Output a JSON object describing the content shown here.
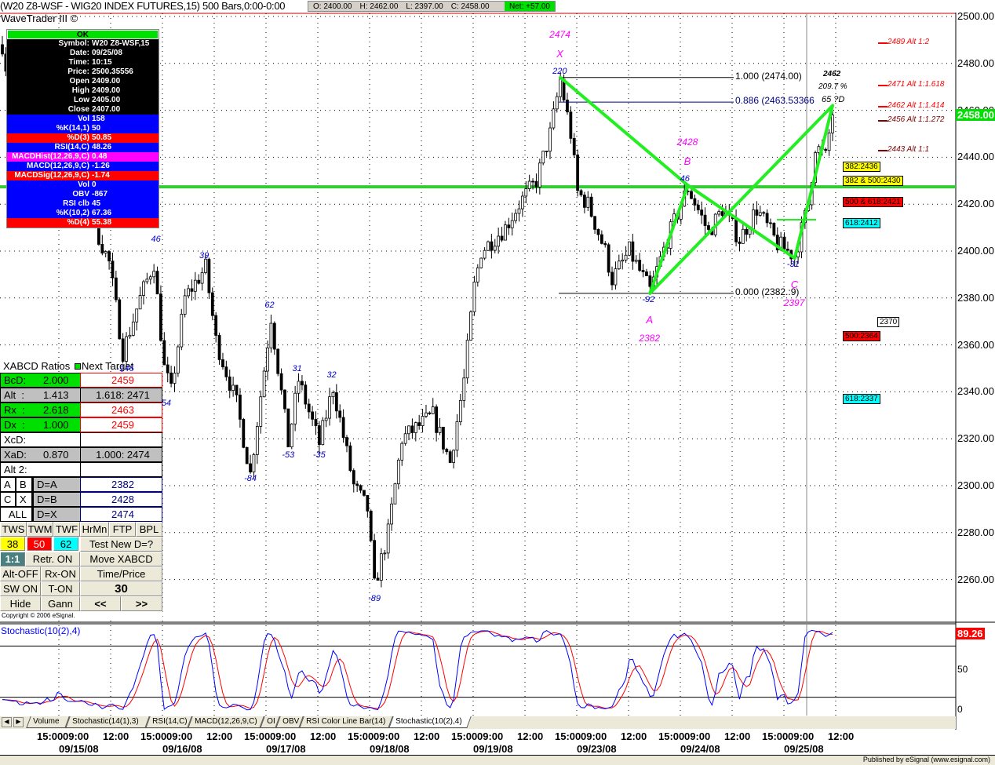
{
  "header": {
    "title": "(W20 Z8-WSF - WIG20 INDEX FUTURES,15) 500 Bars,0:00-0:00",
    "open": "O: 2400.00",
    "high": "H: 2462.00",
    "low": "L: 2397.00",
    "close": "C: 2458.00",
    "net": "Net: +57.00",
    "study_name": "WaveTrader III ©"
  },
  "info_panel": [
    {
      "label": "",
      "value": "OK",
      "bg": "#00e000",
      "fg": "#000"
    },
    {
      "label": "Symbol:",
      "value": "W20 Z8-WSF,15",
      "bg": "#000",
      "fg": "#fff"
    },
    {
      "label": "Date:",
      "value": "09/25/08",
      "bg": "#000",
      "fg": "#fff"
    },
    {
      "label": "Time:",
      "value": "10:15",
      "bg": "#000",
      "fg": "#fff"
    },
    {
      "label": "Price:",
      "value": "2500.35556",
      "bg": "#000",
      "fg": "#fff"
    },
    {
      "label": "Open",
      "value": "2409.00",
      "bg": "#000",
      "fg": "#fff"
    },
    {
      "label": "High",
      "value": "2409.00",
      "bg": "#000",
      "fg": "#fff"
    },
    {
      "label": "Low",
      "value": "2405.00",
      "bg": "#000",
      "fg": "#fff"
    },
    {
      "label": "Close",
      "value": "2407.00",
      "bg": "#000",
      "fg": "#fff"
    },
    {
      "label": "Vol",
      "value": "158",
      "bg": "#0000ff",
      "fg": "#fff"
    },
    {
      "label": "%K(14,1)",
      "value": "50",
      "bg": "#0000ff",
      "fg": "#fff"
    },
    {
      "label": "%D(3)",
      "value": "50.85",
      "bg": "#ff0000",
      "fg": "#fff"
    },
    {
      "label": "RSI(14,C)",
      "value": "48.26",
      "bg": "#0000ff",
      "fg": "#fff"
    },
    {
      "label": "MACDHist(12,26,9,C)",
      "value": "0.48",
      "bg": "#ff00ff",
      "fg": "#fff"
    },
    {
      "label": "MACD(12,26,9,C)",
      "value": "-1.26",
      "bg": "#0000ff",
      "fg": "#fff"
    },
    {
      "label": "MACDSig(12,26,9,C)",
      "value": "-1.74",
      "bg": "#ff0000",
      "fg": "#fff"
    },
    {
      "label": "Vol",
      "value": "0",
      "bg": "#0000ff",
      "fg": "#fff"
    },
    {
      "label": "OBV",
      "value": "-867",
      "bg": "#0000ff",
      "fg": "#fff"
    },
    {
      "label": "RSI clb",
      "value": "45",
      "bg": "#0000ff",
      "fg": "#fff"
    },
    {
      "label": "%K(10,2)",
      "value": "67.36",
      "bg": "#0000ff",
      "fg": "#fff"
    },
    {
      "label": "%D(4)",
      "value": "55.38",
      "bg": "#ff0000",
      "fg": "#fff"
    }
  ],
  "xabcd": {
    "header": "XABCD Ratios",
    "header2": "Next Target",
    "rows": [
      {
        "label": "BcD:",
        "ratio": "2.000",
        "target": "2459",
        "bg": "#00e000",
        "tcolor": "#ff0000",
        "tbg": "#fff"
      },
      {
        "label": "Alt  :",
        "ratio": "1.413",
        "target": "1.618: 2471",
        "bg": "#c0c0c0",
        "tcolor": "#000",
        "tbg": "#c0c0c0"
      },
      {
        "label": "Rx  :",
        "ratio": "2.618",
        "target": "2463",
        "bg": "#00e000",
        "tcolor": "#ff0000",
        "tbg": "#fff"
      },
      {
        "label": "Dx  :",
        "ratio": "1.000",
        "target": "2459",
        "bg": "#00e000",
        "tcolor": "#ff0000",
        "tbg": "#fff"
      },
      {
        "label": "XcD:",
        "ratio": "",
        "target": "",
        "bg": "#fff",
        "tcolor": "#000",
        "tbg": "#fff"
      },
      {
        "label": "XaD:",
        "ratio": "0.870",
        "target": "1.000: 2474",
        "bg": "#c0c0c0",
        "tcolor": "#000",
        "tbg": "#c0c0c0"
      },
      {
        "label": "Alt 2:",
        "ratio": "",
        "target": "",
        "bg": "#fff",
        "tcolor": "#000",
        "tbg": "#fff"
      }
    ],
    "d_rows": [
      {
        "a": "A",
        "b": "B",
        "label": "D=A",
        "value": "2382"
      },
      {
        "a": "C",
        "b": "X",
        "label": "D=B",
        "value": "2428"
      },
      {
        "a": "ALL",
        "b": "",
        "label": "D=X",
        "value": "2474"
      }
    ],
    "buttons_row1": [
      "TWS",
      "TWM",
      "TWF",
      "HrMn",
      "FTP",
      "BPL"
    ],
    "fib_buttons": [
      {
        "label": "38",
        "bg": "#ffff00"
      },
      {
        "label": "50",
        "bg": "#ff0000"
      },
      {
        "label": "62",
        "bg": "#00ffff"
      }
    ],
    "test_new_d": "Test New D=?",
    "one_to_one": "1:1",
    "retr": "Retr. ON",
    "move": "Move XABCD",
    "alt_off": "Alt-OFF",
    "rx_on": "Rx-ON",
    "time_price": "Time/Price",
    "sw_on": "SW ON",
    "t_on": "T-ON",
    "bars": "30",
    "hide": "Hide",
    "gann": "Gann",
    "prev": "<<",
    "next": ">>",
    "copyright": "Copyright © 2006 eSignal."
  },
  "price_axis": {
    "ticks": [
      2500,
      2480,
      2460,
      2440,
      2420,
      2400,
      2380,
      2360,
      2340,
      2320,
      2300,
      2280,
      2260
    ],
    "labels": [
      "2500.00",
      "2480.00",
      "2460.00",
      "2440.00",
      "2420.00",
      "2400.00",
      "2380.00",
      "2360.00",
      "2340.00",
      "2320.00",
      "2300.00",
      "2280.00",
      "2260.00"
    ],
    "current": "2458.00",
    "current_value": 2458,
    "green_line_value": 2427.4
  },
  "stoch_axis": {
    "labels": [
      "50",
      "0"
    ],
    "current": "89.26",
    "title": "Stochastic(10(2),4)"
  },
  "price_pivots": [
    [
      0,
      2488
    ],
    [
      2,
      2470
    ],
    [
      10,
      2455
    ],
    [
      20,
      2440
    ],
    [
      27,
      2410
    ],
    [
      31,
      2395
    ],
    [
      35,
      2357
    ],
    [
      40,
      2380
    ],
    [
      44,
      2395
    ],
    [
      47,
      2350
    ],
    [
      49,
      2340
    ],
    [
      53,
      2380
    ],
    [
      59,
      2393
    ],
    [
      62,
      2362
    ],
    [
      68,
      2335
    ],
    [
      72,
      2305
    ],
    [
      78,
      2372
    ],
    [
      83,
      2318
    ],
    [
      86,
      2345
    ],
    [
      92,
      2318
    ],
    [
      96,
      2342
    ],
    [
      102,
      2300
    ],
    [
      106,
      2290
    ],
    [
      108,
      2257
    ],
    [
      112,
      2280
    ],
    [
      116,
      2320
    ],
    [
      125,
      2330
    ],
    [
      130,
      2310
    ],
    [
      134,
      2345
    ],
    [
      137,
      2385
    ],
    [
      139,
      2400
    ],
    [
      146,
      2410
    ],
    [
      150,
      2420
    ],
    [
      155,
      2430
    ],
    [
      159,
      2450
    ],
    [
      162,
      2473
    ],
    [
      165,
      2450
    ],
    [
      167,
      2425
    ],
    [
      170,
      2420
    ],
    [
      175,
      2400
    ],
    [
      177,
      2388
    ],
    [
      182,
      2400
    ],
    [
      188,
      2383
    ],
    [
      193,
      2405
    ],
    [
      199,
      2427
    ],
    [
      205,
      2408
    ],
    [
      209,
      2418
    ],
    [
      214,
      2405
    ],
    [
      219,
      2418
    ],
    [
      225,
      2403
    ],
    [
      230,
      2398
    ],
    [
      234,
      2420
    ],
    [
      236,
      2445
    ],
    [
      239,
      2440
    ],
    [
      241,
      2460
    ],
    [
      241.5,
      2457
    ]
  ],
  "pattern": {
    "X": {
      "bar": 162,
      "price": 2474,
      "price_label": "2474",
      "letter": "X",
      "swing": "220"
    },
    "A": {
      "bar": 188,
      "price": 2382,
      "price_label": "2382",
      "letter": "A",
      "swing": "-92"
    },
    "B": {
      "bar": 199,
      "price": 2428,
      "price_label": "2428",
      "letter": "B",
      "swing": "46"
    },
    "C": {
      "bar": 230,
      "price": 2397,
      "price_label": "2397",
      "letter": "C",
      "swing": "-31"
    },
    "D": {
      "bar": 241,
      "price": 2462,
      "price_label": "2462",
      "pct": "209.7 %",
      "tag": "65 ?D"
    }
  },
  "swing_labels": [
    {
      "bar": 45,
      "price": 2405,
      "text": "46"
    },
    {
      "bar": 35,
      "price": 2350,
      "text": "-146"
    },
    {
      "bar": 48,
      "price": 2335,
      "text": "54"
    },
    {
      "bar": 59,
      "price": 2398,
      "text": "39"
    },
    {
      "bar": 72,
      "price": 2303,
      "text": "-84"
    },
    {
      "bar": 78,
      "price": 2377,
      "text": "62"
    },
    {
      "bar": 83,
      "price": 2313,
      "text": "-53"
    },
    {
      "bar": 86,
      "price": 2350,
      "text": "31"
    },
    {
      "bar": 92,
      "price": 2313,
      "text": "-35"
    },
    {
      "bar": 96,
      "price": 2347,
      "text": "32"
    },
    {
      "bar": 108,
      "price": 2252,
      "text": "-89"
    }
  ],
  "fib_levels": [
    {
      "price": 2474,
      "text": "1.000 (2474.00)",
      "color": "#000"
    },
    {
      "price": 2463.5,
      "text": "0.886 (2463.53366",
      "color": "#000080"
    },
    {
      "price": 2382,
      "text": "0.000 (2382.:9)",
      "color": "#000"
    }
  ],
  "alt_targets": [
    {
      "price": 2489,
      "text": "2489 Alt 1:2",
      "color": "#ff0000"
    },
    {
      "price": 2471,
      "text": "2471 Alt 1:1.618",
      "color": "#ff0000"
    },
    {
      "price": 2462,
      "text": "2462 Alt 1:1.414",
      "color": "#ff0000"
    },
    {
      "price": 2456,
      "text": "2456 Alt 1:1.272",
      "color": "#800000"
    },
    {
      "price": 2443,
      "text": "2443 Alt 1:1",
      "color": "#800000"
    }
  ],
  "retr_tags": [
    {
      "price": 2436,
      "text": "382:2436",
      "bg": "#ffff00"
    },
    {
      "price": 2430,
      "text": "382 & 500:2430",
      "bg": "#ffff00"
    },
    {
      "price": 2421,
      "text": "500 & 618:2421",
      "bg": "#ff0000"
    },
    {
      "price": 2412,
      "text": "618:2412",
      "bg": "#00ffff"
    },
    {
      "price": 2370,
      "text": "2370",
      "bg": "#fff"
    },
    {
      "price": 2364,
      "text": "500:2364",
      "bg": "#ff0000"
    },
    {
      "price": 2337,
      "text": "618:2337",
      "bg": "#00ffff"
    }
  ],
  "tabs": [
    "Volume",
    "Stochastic(14(1),3)",
    "RSI(14,C)",
    "MACD(12,26,9,C)",
    "OI",
    "OBV",
    "RSI Color Line Bar(14)",
    "Stochastic(10(2),4)"
  ],
  "active_tab": 7,
  "time_axis": {
    "intraday": [
      "15:00",
      "09:00",
      "12:00"
    ],
    "dates": [
      "09/15/08",
      "09/16/08",
      "09/17/08",
      "09/18/08",
      "09/19/08",
      "09/23/08",
      "09/24/08",
      "09/25/08"
    ]
  },
  "status": "Published by eSignal (www.esignal.com)",
  "colors": {
    "pattern": "#22ee22",
    "hline": "#33cc33",
    "stoch_k": "#0000ff",
    "stoch_d": "#ff0000",
    "swing": "#0000cc",
    "pattern_label": "#ff00ff"
  }
}
